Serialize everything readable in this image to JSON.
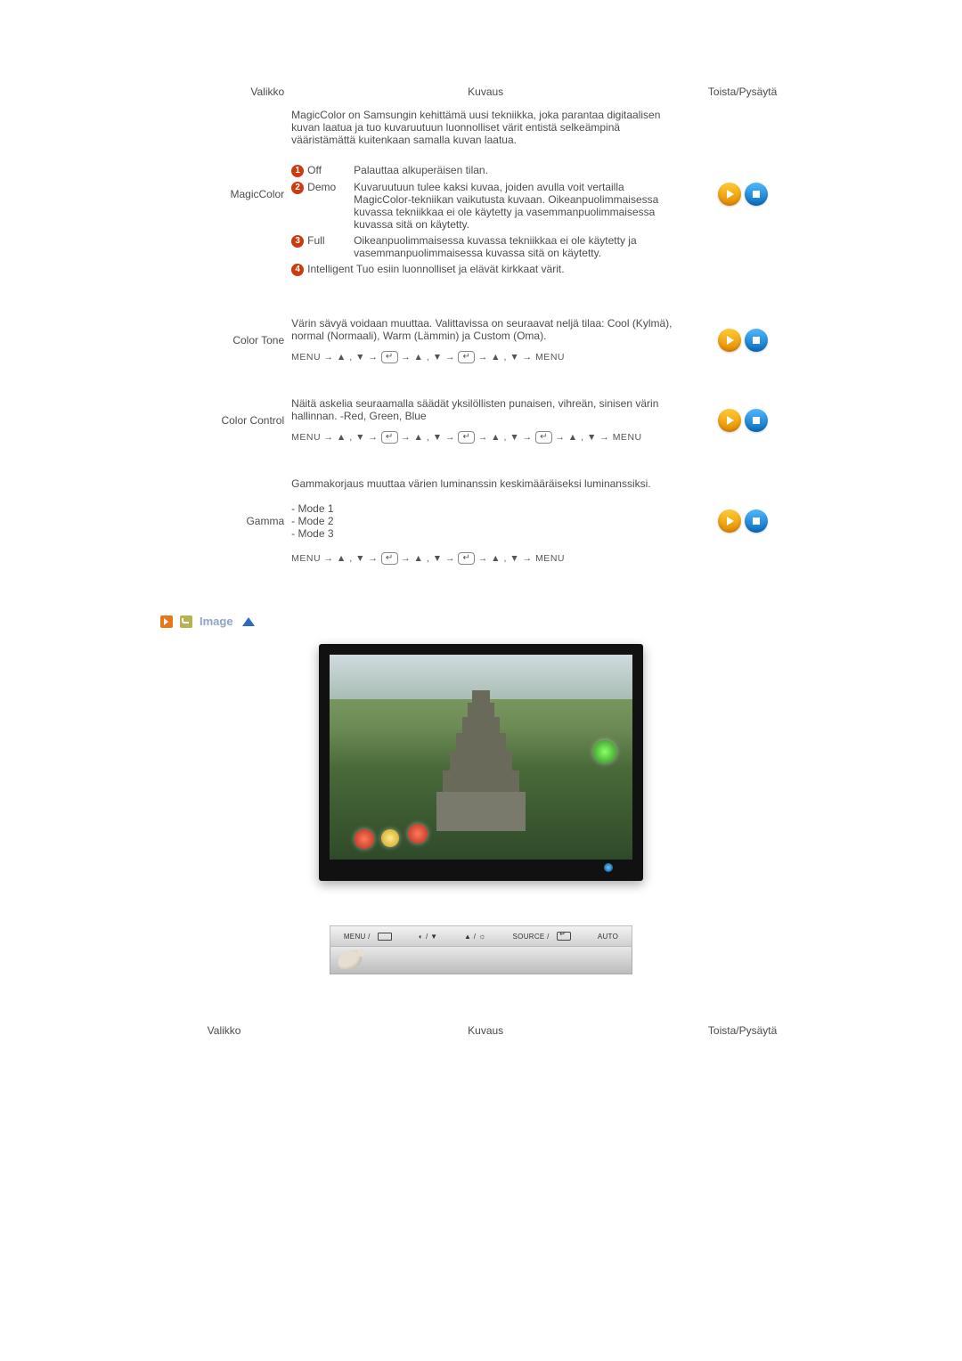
{
  "headers": {
    "menu": "Valikko",
    "desc": "Kuvaus",
    "play": "Toista/Pysäytä"
  },
  "rows": {
    "magiccolor": {
      "name": "MagicColor",
      "intro": "MagicColor on Samsungin kehittämä uusi tekniikka, joka parantaa digitaalisen kuvan laatua ja tuo kuvaruutuun luonnolliset värit entistä selkeämpinä vääristämättä kuitenkaan samalla kuvan laatua.",
      "opts": {
        "off": {
          "label": "Off",
          "desc": "Palauttaa alkuperäisen tilan."
        },
        "demo": {
          "label": "Demo",
          "desc": "Kuvaruutuun tulee kaksi kuvaa, joiden avulla voit vertailla MagicColor-tekniikan vaikutusta kuvaan. Oikeanpuolimmaisessa kuvassa tekniikkaa ei ole käytetty ja vasemmanpuolimmaisessa kuvassa sitä on käytetty."
        },
        "full": {
          "label": "Full",
          "desc": "Oikeanpuolimmaisessa kuvassa tekniikkaa ei ole käytetty ja vasemmanpuolimmaisessa kuvassa sitä on käytetty."
        },
        "intel": {
          "label": "Intelligent",
          "desc": "Tuo esiin luonnolliset ja elävät kirkkaat värit."
        }
      }
    },
    "colortone": {
      "name": "Color Tone",
      "desc": "Värin sävyä voidaan muuttaa. Valittavissa on seuraavat neljä tilaa: Cool (Kylmä), normal (Normaali), Warm (Lämmin) ja Custom (Oma)."
    },
    "colorcontrol": {
      "name": "Color Control",
      "desc": "Näitä askelia seuraamalla säädät yksilöllisten punaisen, vihreän, sinisen värin hallinnan. -Red, Green, Blue"
    },
    "gamma": {
      "name": "Gamma",
      "desc": "Gammakorjaus muuttaa värien luminanssin keskimääräiseksi luminanssiksi.",
      "modes": [
        "- Mode 1",
        "- Mode 2",
        "- Mode 3"
      ]
    }
  },
  "menupath": {
    "menu": "MENU",
    "arrow": "→",
    "updown": "▲ , ▼"
  },
  "section": {
    "image": "Image"
  },
  "strip": {
    "menu": "MENU /",
    "mb_arrow": "/ ▼",
    "bright_up": "▲ /",
    "source": "SOURCE /",
    "auto": "AUTO"
  }
}
